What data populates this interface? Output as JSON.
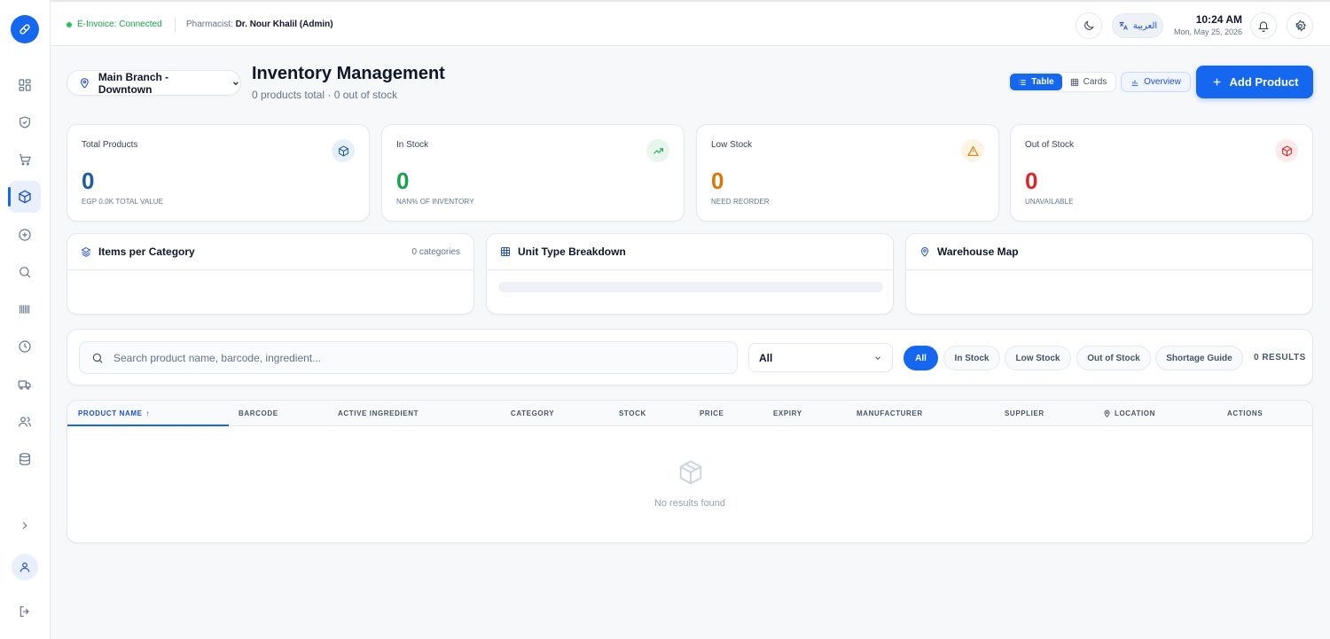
{
  "topbar": {
    "einvoice_status": "E-Invoice: Connected",
    "pharmacist_label": "Pharmacist:",
    "pharmacist_name": "Dr. Nour Khalil (Admin)",
    "language_label": "العربية",
    "time": "10:24 AM",
    "date": "Mon, May 25, 2026"
  },
  "sidebar": {
    "items": [
      {
        "name": "dashboard",
        "icon": "grid-icon"
      },
      {
        "name": "security",
        "icon": "shield-icon"
      },
      {
        "name": "sales",
        "icon": "cart-icon"
      },
      {
        "name": "inventory",
        "icon": "box-icon",
        "active": true
      },
      {
        "name": "add",
        "icon": "plus-circle-icon"
      },
      {
        "name": "search",
        "icon": "search-icon"
      },
      {
        "name": "barcode",
        "icon": "barcode-icon"
      },
      {
        "name": "history",
        "icon": "clock-icon"
      },
      {
        "name": "delivery",
        "icon": "truck-icon"
      },
      {
        "name": "customers",
        "icon": "users-icon"
      },
      {
        "name": "database",
        "icon": "database-icon"
      }
    ]
  },
  "header": {
    "branch": "Main Branch - Downtown",
    "title": "Inventory Management",
    "subtitle": "0 products total · 0 out of stock",
    "view_table": "Table",
    "view_cards": "Cards",
    "overview": "Overview",
    "add_product": "Add Product"
  },
  "stats": [
    {
      "label": "Total Products",
      "value": "0",
      "caption": "EGP 0.0K TOTAL VALUE",
      "color": "#1e5aa8"
    },
    {
      "label": "In Stock",
      "value": "0",
      "caption": "NAN% OF INVENTORY",
      "color": "#16a34a"
    },
    {
      "label": "Low Stock",
      "value": "0",
      "caption": "NEED REORDER",
      "color": "#d97706"
    },
    {
      "label": "Out of Stock",
      "value": "0",
      "caption": "UNAVAILABLE",
      "color": "#dc2626"
    }
  ],
  "panels": {
    "category": {
      "title": "Items per Category",
      "meta": "0 categories"
    },
    "unit": {
      "title": "Unit Type Breakdown"
    },
    "warehouse": {
      "title": "Warehouse Map"
    }
  },
  "filters": {
    "search_placeholder": "Search product name, barcode, ingredient...",
    "select_value": "All",
    "chips": [
      "All",
      "In Stock",
      "Low Stock",
      "Out of Stock",
      "Shortage Guide"
    ],
    "results": "0 RESULTS"
  },
  "table": {
    "columns": [
      "PRODUCT NAME",
      "BARCODE",
      "ACTIVE INGREDIENT",
      "CATEGORY",
      "STOCK",
      "PRICE",
      "EXPIRY",
      "MANUFACTURER",
      "SUPPLIER",
      "LOCATION",
      "ACTIONS"
    ],
    "sort_indicator": "↑",
    "empty_message": "No results found"
  },
  "colors": {
    "accent": "#1567f0"
  }
}
